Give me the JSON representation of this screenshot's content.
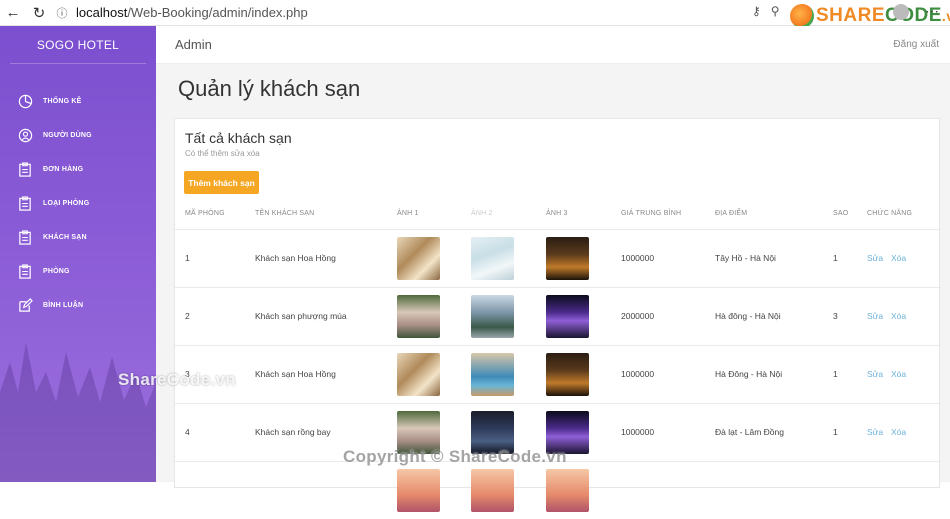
{
  "browser": {
    "url_host": "localhost",
    "url_path": "/Web-Booking/admin/index.php"
  },
  "brand_logo": {
    "left": "SHARE",
    "right": "CODE",
    "suffix": ".vn"
  },
  "sidebar": {
    "brand": "SOGO HOTEL",
    "items": [
      {
        "label": "THỐNG KÊ",
        "icon": "pie-chart-icon"
      },
      {
        "label": "NGƯỜI DÙNG",
        "icon": "user-icon"
      },
      {
        "label": "ĐƠN HÀNG",
        "icon": "clipboard-icon"
      },
      {
        "label": "LOẠI PHÒNG",
        "icon": "clipboard-icon"
      },
      {
        "label": "KHÁCH SẠN",
        "icon": "clipboard-icon"
      },
      {
        "label": "PHÒNG",
        "icon": "clipboard-icon"
      },
      {
        "label": "BÌNH LUẬN",
        "icon": "edit-icon"
      }
    ]
  },
  "header": {
    "title": "Admin",
    "logout": "Đăng xuất"
  },
  "main": {
    "page_title": "Quản lý khách sạn",
    "card_title": "Tất cả khách sạn",
    "card_subtitle": "Có thể thêm sửa xóa",
    "add_button": "Thêm khách sạn",
    "columns": [
      "MÃ PHÒNG",
      "TÊN KHÁCH SẠN",
      "ẢNH 1",
      "ẢNH 2",
      "ẢNH 3",
      "GIÁ TRUNG BÌNH",
      "ĐỊA ĐIỂM",
      "SAO",
      "CHỨC NĂNG"
    ],
    "rows": [
      {
        "id": "1",
        "name": "Khách sạn Hoa Hồng",
        "price": "1000000",
        "location": "Tây Hồ - Hà Nội",
        "stars": "1",
        "edit": "Sửa",
        "delete": "Xóa",
        "img": [
          "t-lobby",
          "t-pool",
          "t-night"
        ]
      },
      {
        "id": "2",
        "name": "Khách sạn phượng múa",
        "price": "2000000",
        "location": "Hà đông - Hà Nội",
        "stars": "3",
        "edit": "Sửa",
        "delete": "Xóa",
        "img": [
          "t-villa",
          "t-tower",
          "t-purple"
        ]
      },
      {
        "id": "3",
        "name": "Khách sạn Hoa Hồng",
        "price": "1000000",
        "location": "Hà Đông - Hà Nội",
        "stars": "1",
        "edit": "Sửa",
        "delete": "Xóa",
        "img": [
          "t-lobby",
          "t-resort",
          "t-night"
        ]
      },
      {
        "id": "4",
        "name": "Khách sạn rồng bay",
        "price": "1000000",
        "location": "Đà lạt - Lâm Đồng",
        "stars": "1",
        "edit": "Sửa",
        "delete": "Xóa",
        "img": [
          "t-villa",
          "t-city",
          "t-purple"
        ]
      },
      {
        "id": "",
        "name": "",
        "price": "",
        "location": "",
        "stars": "",
        "edit": "",
        "delete": "",
        "img": [
          "t-sunset",
          "t-sunset",
          "t-sunset"
        ]
      }
    ]
  },
  "watermarks": {
    "sidebar": "ShareCode.vn",
    "footer": "Copyright © ShareCode.vn"
  }
}
